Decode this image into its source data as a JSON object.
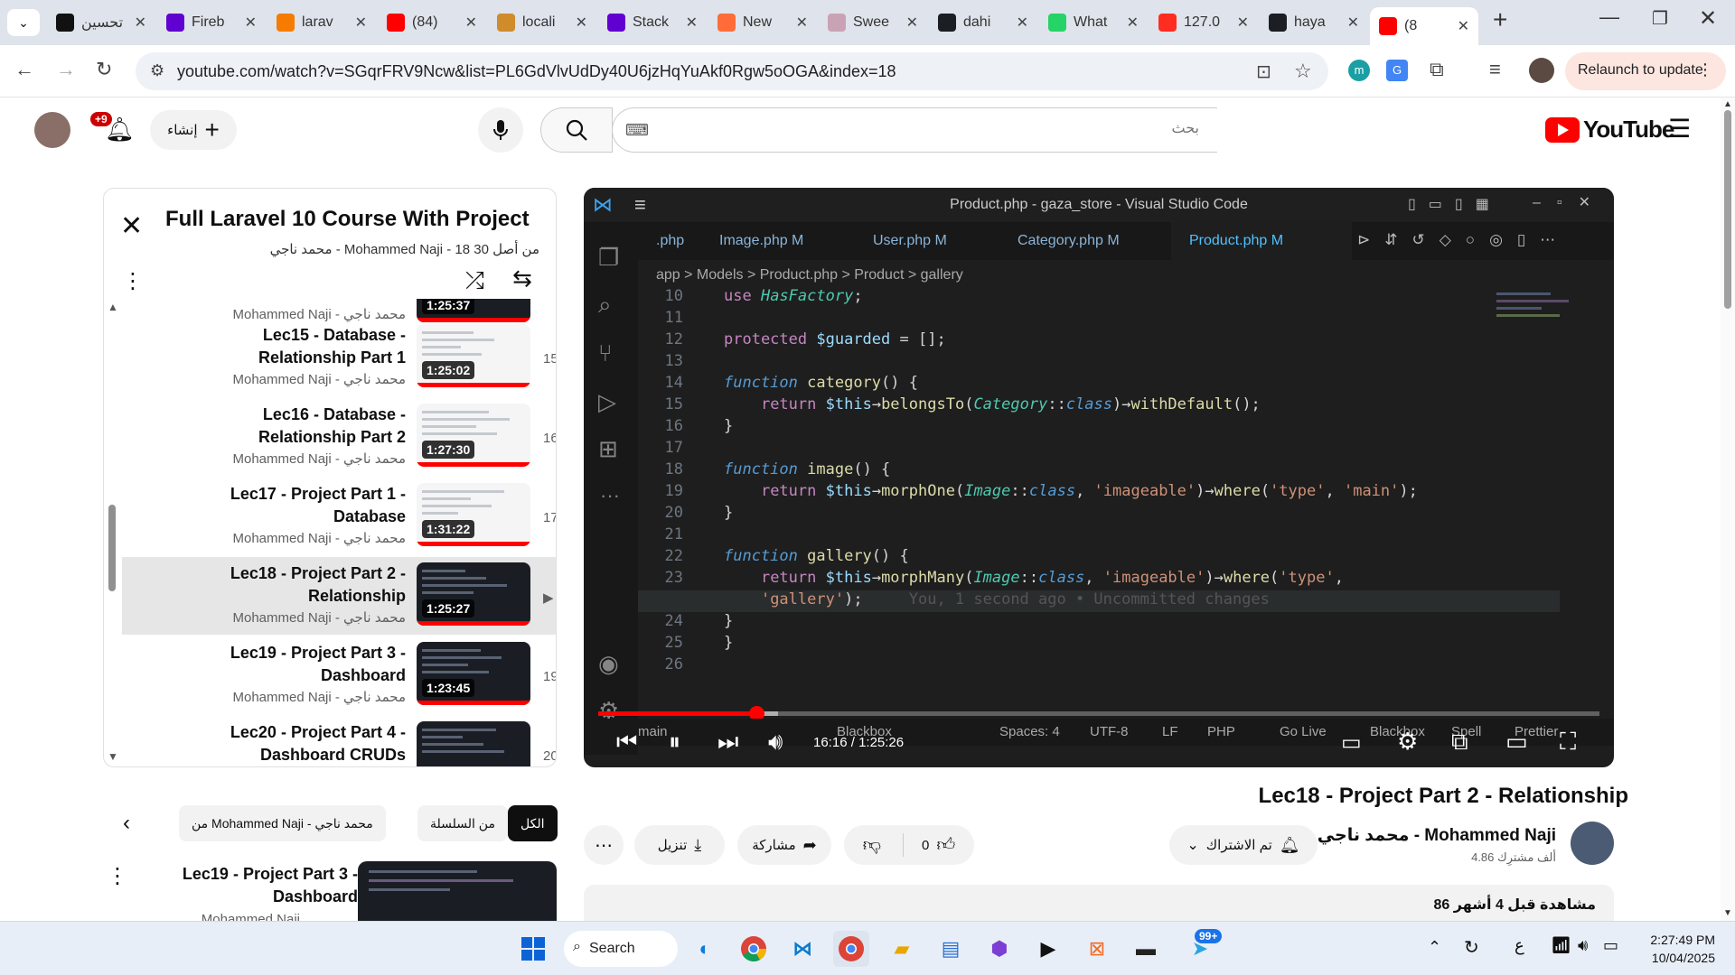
{
  "browser": {
    "tabs": [
      {
        "label": "تحسين",
        "icon": "threads-icon",
        "color": "#111111"
      },
      {
        "label": "Fireb",
        "icon": "yahoo-icon",
        "color": "#6001d2"
      },
      {
        "label": "larav",
        "icon": "firebase-icon",
        "color": "#f57c00"
      },
      {
        "label": "(84)",
        "icon": "youtube-icon",
        "color": "#ff0000"
      },
      {
        "label": "locali",
        "icon": "pma-icon",
        "color": "#d08b2c"
      },
      {
        "label": "Stack",
        "icon": "yahoo-icon",
        "color": "#6001d2"
      },
      {
        "label": "New",
        "icon": "postman-icon",
        "color": "#ff6c37"
      },
      {
        "label": "Swee",
        "icon": "sweetalert-icon",
        "color": "#c9a3b5"
      },
      {
        "label": "dahi",
        "icon": "github-icon",
        "color": "#1b1f23"
      },
      {
        "label": "What",
        "icon": "whatsapp-icon",
        "color": "#25d366"
      },
      {
        "label": "127.0",
        "icon": "laravel-icon",
        "color": "#ff2d20"
      },
      {
        "label": "haya",
        "icon": "github-icon",
        "color": "#1b1f23"
      },
      {
        "label": "(8",
        "icon": "youtube-icon",
        "color": "#ff0000"
      }
    ],
    "url": "youtube.com/watch?v=SGqrFRV9Ncw&list=PL6GdVlvUdDy40U6jzHqYuAkf0Rgw5oOGA&index=18",
    "relaunch_label": "Relaunch to update"
  },
  "youtube": {
    "logo_text": "YouTube",
    "search_placeholder": "بحث",
    "create_label": "إنشاء",
    "notif_badge": "+9"
  },
  "playlist": {
    "title": "Full Laravel 10 Course With Project",
    "subtitle": "محمد ناجي - Mohammed Naji - 18 من أصل 30",
    "items": [
      {
        "title": "",
        "channel": "Mohammed Naji - محمد ناجي",
        "duration": "1:25:37",
        "num": "",
        "dark": true
      },
      {
        "title": "Lec15 - Database - Relationship Part 1",
        "channel": "Mohammed Naji - محمد ناجي",
        "duration": "1:25:02",
        "num": "15",
        "dark": false
      },
      {
        "title": "Lec16 - Database - Relationship Part 2",
        "channel": "Mohammed Naji - محمد ناجي",
        "duration": "1:27:30",
        "num": "16",
        "dark": false
      },
      {
        "title": "Lec17 - Project Part 1 - Database",
        "channel": "Mohammed Naji - محمد ناجي",
        "duration": "1:31:22",
        "num": "17",
        "dark": false
      },
      {
        "title": "Lec18 - Project Part 2 - Relationship",
        "channel": "Mohammed Naji - محمد ناجي",
        "duration": "1:25:27",
        "num": "▶",
        "dark": true
      },
      {
        "title": "Lec19 - Project Part 3 - Dashboard",
        "channel": "Mohammed Naji - محمد ناجي",
        "duration": "1:23:45",
        "num": "19",
        "dark": true
      },
      {
        "title": "Lec20 - Project Part 4 - Dashboard CRUDs",
        "channel": "",
        "duration": "",
        "num": "20",
        "dark": true
      }
    ]
  },
  "video": {
    "window_title": "Product.php - gaza_store - Visual Studio Code",
    "editor_tabs": [
      ".php",
      "Image.php M",
      "User.php M",
      "Category.php M",
      "Product.php M"
    ],
    "breadcrumb": "app > Models > Product.php > Product > gallery",
    "code_lines": [
      {
        "n": "10",
        "html": "<span class='k'>use</span> <span class='cls'>HasFactory</span>;"
      },
      {
        "n": "11",
        "html": ""
      },
      {
        "n": "12",
        "html": "<span class='k'>protected</span> <span class='var'>$guarded</span> = [];"
      },
      {
        "n": "13",
        "html": ""
      },
      {
        "n": "14",
        "html": "<span class='kb'>function</span> <span class='fn'>category</span>() {"
      },
      {
        "n": "15",
        "html": "    <span class='k'>return</span> <span class='var'>$this</span>→<span class='fn'>belongsTo</span>(<span class='cls'>Category</span>::<span class='kb'>class</span>)→<span class='fn'>withDefault</span>();"
      },
      {
        "n": "16",
        "html": "}"
      },
      {
        "n": "17",
        "html": ""
      },
      {
        "n": "18",
        "html": "<span class='kb'>function</span> <span class='fn'>image</span>() {"
      },
      {
        "n": "19",
        "html": "    <span class='k'>return</span> <span class='var'>$this</span>→<span class='fn'>morphOne</span>(<span class='cls'>Image</span>::<span class='kb'>class</span>, <span class='st'>'imageable'</span>)→<span class='fn'>where</span>(<span class='st'>'type'</span>, <span class='st'>'main'</span>);"
      },
      {
        "n": "20",
        "html": "}"
      },
      {
        "n": "21",
        "html": ""
      },
      {
        "n": "22",
        "html": "<span class='kb'>function</span> <span class='fn'>gallery</span>() {"
      },
      {
        "n": "23",
        "html": "    <span class='k'>return</span> <span class='var'>$this</span>→<span class='fn'>morphMany</span>(<span class='cls'>Image</span>::<span class='kb'>class</span>, <span class='st'>'imageable'</span>)→<span class='fn'>where</span>(<span class='st'>'type'</span>,"
      },
      {
        "n": "",
        "html": "    <span class='st'>'gallery'</span>);     <span style='color:#555'>You, 1 second ago • Uncommitted changes</span>"
      },
      {
        "n": "24",
        "html": "}"
      },
      {
        "n": "25",
        "html": "}"
      },
      {
        "n": "26",
        "html": ""
      }
    ],
    "status_items": [
      "main",
      "Blackbox",
      "Spaces: 4",
      "UTF-8",
      "LF",
      "PHP",
      "Go Live",
      "Blackbox",
      "Spell",
      "Prettier"
    ],
    "time_current": "16:16",
    "time_total": "1:25:26",
    "progress_fraction": 0.158,
    "buffered_fraction": 0.18
  },
  "details": {
    "title": "Lec18 - Project Part 2 - Relationship",
    "channel": "محمد ناجي - Mohammed Naji",
    "subscribers": "4.86 ألف مشترِك",
    "subscribed_label": "تم الاشتراك",
    "likes": "0",
    "share_label": "مشاركة",
    "download_label": "تنزيل",
    "views": "86 مشاهدة  قبل 4 أشهر"
  },
  "chips": [
    "الكل",
    "من السلسلة",
    "من Mohammed Naji - محمد ناجي"
  ],
  "related": {
    "title": "Lec19 - Project Part 3 - Dashboard",
    "channel": "Mohammed Naji"
  },
  "taskbar": {
    "search_label": "Search",
    "telegram_badge": "99+",
    "lang": "ع",
    "time": "2:27:49 PM",
    "date": "10/04/2025"
  }
}
